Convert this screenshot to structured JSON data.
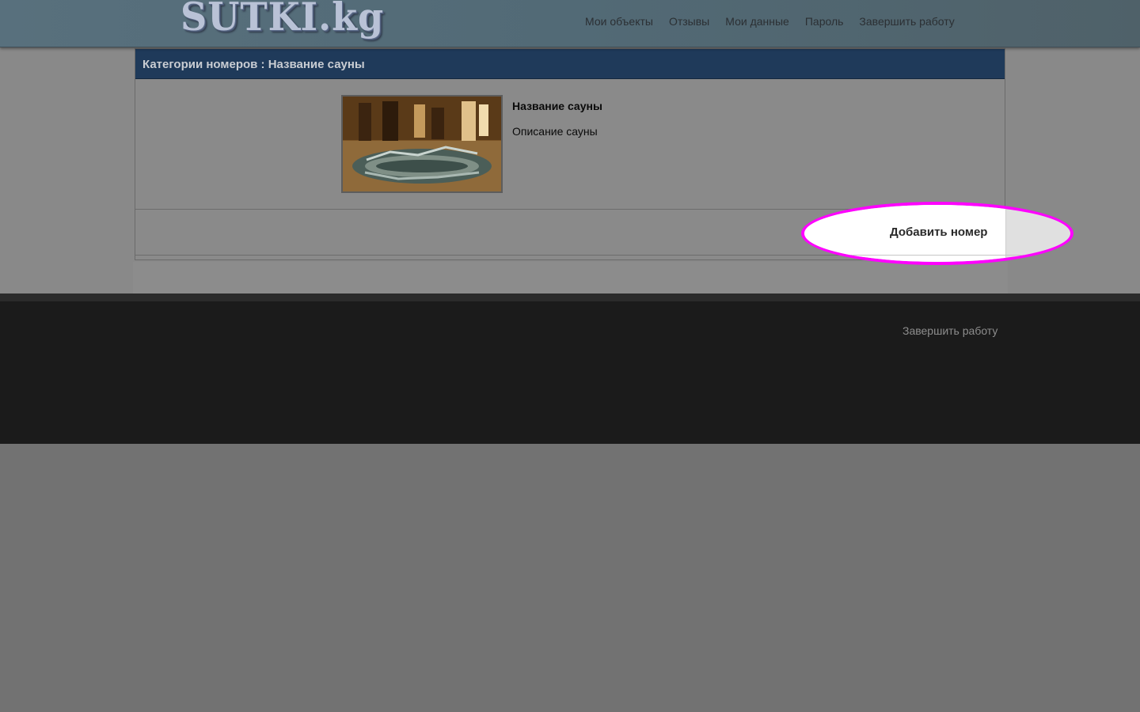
{
  "header": {
    "logo_text": "SUTKI.kg",
    "nav": [
      {
        "label": "Мои объекты"
      },
      {
        "label": "Отзывы"
      },
      {
        "label": "Мои данные"
      },
      {
        "label": "Пароль"
      },
      {
        "label": "Завершить работу"
      }
    ]
  },
  "panel": {
    "title": "Категории номеров : Название сауны",
    "sauna_name": "Название сауны",
    "sauna_description": "Описание сауны",
    "add_room_label": "Добавить номер"
  },
  "footer": {
    "logout_label": "Завершить работу"
  },
  "colors": {
    "panel_header": "#1f3a5a",
    "highlight": "#ff00ff"
  }
}
